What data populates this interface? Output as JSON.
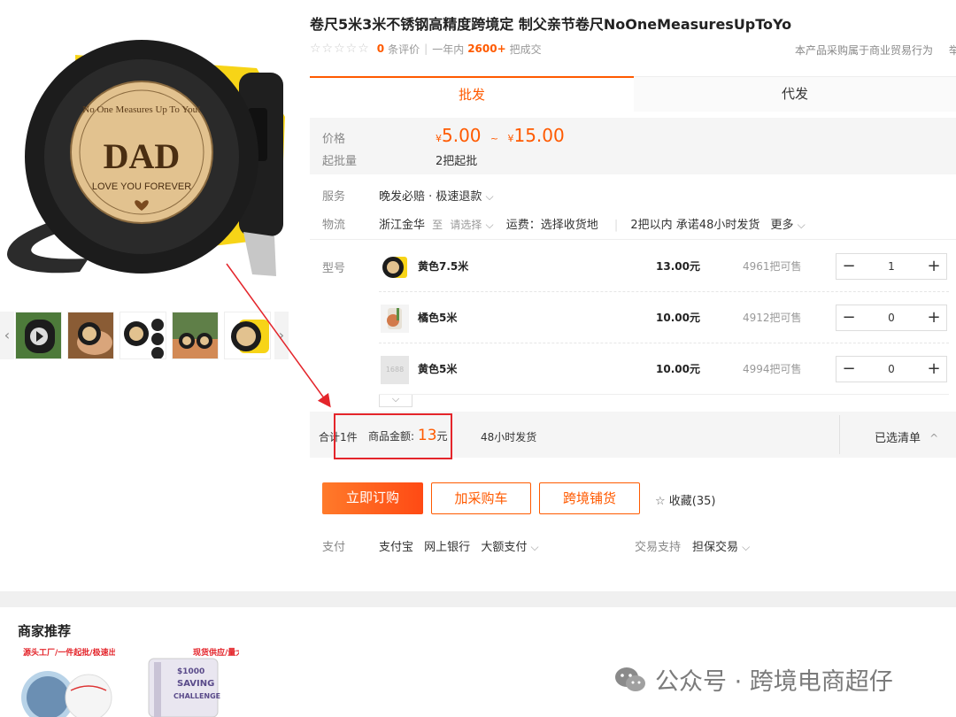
{
  "product": {
    "title": "卷尺5米3米不锈钢高精度跨境定 制父亲节卷尺NoOneMeasuresUpToYo",
    "rating_stars": "☆☆☆☆☆",
    "review_count": "0",
    "review_suffix": "条评价",
    "year_label": "一年内",
    "sold_count": "2600+",
    "sold_suffix": "把成交",
    "trade_note": "本产品采购属于商业贸易行为",
    "report": "举报",
    "image_text": {
      "ring": "No One Measures Up To You!",
      "dad": "DAD",
      "love": "LOVE YOU FOREVER"
    }
  },
  "tabs": [
    {
      "label": "批发"
    },
    {
      "label": "代发"
    }
  ],
  "price": {
    "label": "价格",
    "currency": "¥",
    "low": "5.00",
    "tilde": "~",
    "high": "15.00",
    "moq_label": "起批量",
    "moq_value": "2把起批"
  },
  "service": {
    "label": "服务",
    "value": "晚发必赔 · 极速退款",
    "chev": "⌵"
  },
  "logistics": {
    "label": "物流",
    "origin": "浙江金华",
    "to": "至",
    "select": "请选择",
    "chev": "⌵",
    "freight": "运费：选择收货地",
    "promise": "2把以内 承诺48小时发货",
    "more": "更多",
    "more_chev": "⌵"
  },
  "sku": {
    "label": "型号",
    "rows": [
      {
        "name": "黄色7.5米",
        "price": "13.00元",
        "stock": "4961把可售",
        "qty": "1"
      },
      {
        "name": "橘色5米",
        "price": "10.00元",
        "stock": "4912把可售",
        "qty": "0"
      },
      {
        "name": "黄色5米",
        "price": "10.00元",
        "stock": "4994把可售",
        "qty": "0"
      }
    ],
    "minus": "−",
    "plus": "+",
    "expand": "⌵",
    "placeholder_text": "1688"
  },
  "summary": {
    "total_count": "合计1件",
    "amount_label": "商品金额:",
    "amount_value": "13",
    "amount_unit": "元",
    "ship": "48小时发货",
    "selected_list": "已选清单",
    "caret": "^"
  },
  "actions": {
    "buy_now": "立即订购",
    "add_cart": "加采购车",
    "cross_border": "跨境铺货",
    "fav_icon": "☆",
    "favorite": "收藏(35)"
  },
  "payment": {
    "label": "支付",
    "methods": [
      "支付宝",
      "网上银行",
      "大额支付"
    ],
    "chev": "⌵",
    "support_label": "交易支持",
    "support_value": "担保交易",
    "support_chev": "⌵"
  },
  "recommend": {
    "title": "商家推荐",
    "cards": [
      {
        "tag": "源头工厂/一件起批/极速出货"
      },
      {
        "tag": "现货供应/量大价优"
      }
    ],
    "card2_lines": [
      "$1000",
      "SAVING",
      "CHALLENGE"
    ]
  },
  "watermark": {
    "text": "公众号 · 跨境电商超仔"
  },
  "colors": {
    "accent": "#ff5a00",
    "highlight": "#e4252b",
    "tape_yellow": "#f7d417"
  },
  "icons": {
    "thumb_prev": "‹",
    "thumb_next": "›"
  }
}
